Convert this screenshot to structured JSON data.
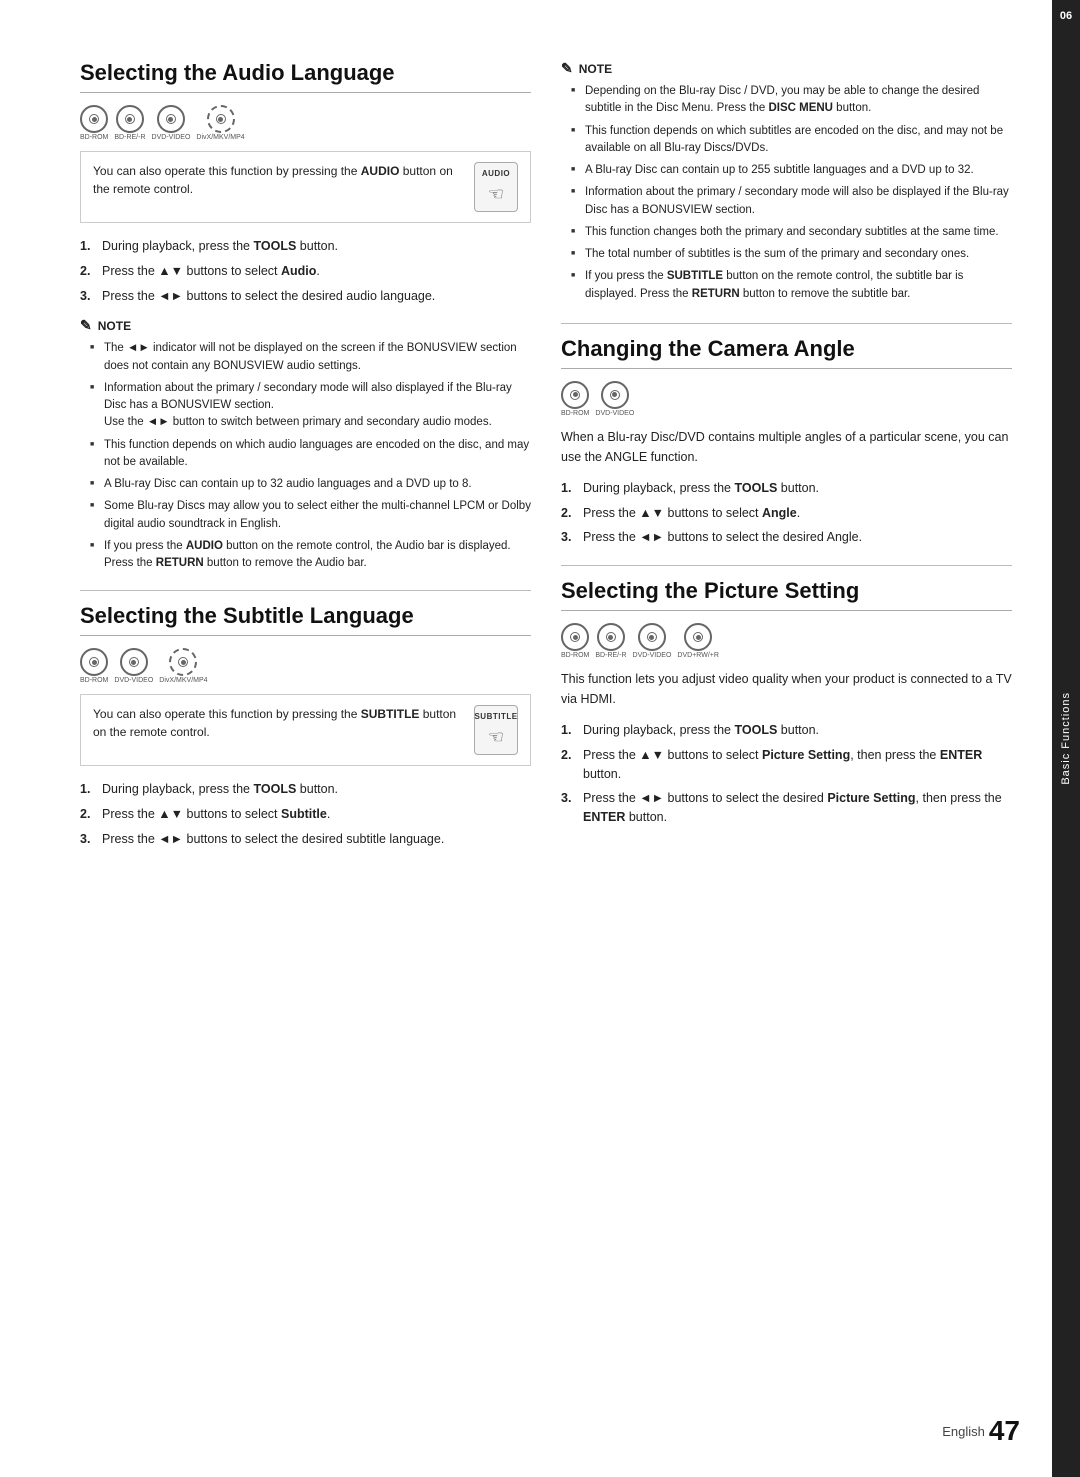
{
  "page": {
    "number": "47",
    "lang": "English"
  },
  "side_tab": {
    "number": "06",
    "label": "Basic Functions"
  },
  "sections": {
    "audio_language": {
      "title": "Selecting the Audio Language",
      "disc_icons": [
        "BD-ROM",
        "BD-RE/-R",
        "DVD-VIDEO",
        "DivX/MKV/MP4"
      ],
      "info_box": {
        "text_before": "You can also operate this function by pressing the ",
        "bold": "AUDIO",
        "text_after": " button on the remote control.",
        "button_label": "AUDIO"
      },
      "steps": [
        {
          "num": "1.",
          "text_before": "During playback, press the ",
          "bold": "TOOLS",
          "text_after": " button."
        },
        {
          "num": "2.",
          "text_before": "Press the ▲▼ buttons to select ",
          "bold": "Audio",
          "text_after": "."
        },
        {
          "num": "3.",
          "text": "Press the ◄► buttons to select the desired audio language."
        }
      ],
      "note": {
        "items": [
          "The ◄► indicator will not be displayed on the screen if the BONUSVIEW section does not contain any BONUSVIEW audio settings.",
          "Information about the primary / secondary mode will also displayed if the Blu-ray Disc has a BONUSVIEW section.\nUse the ◄► button to switch between primary and secondary audio modes.",
          "This function depends on which audio languages are encoded on the disc, and may not be available.",
          "A Blu-ray Disc can contain up to 32 audio languages and a DVD up to 8.",
          "Some Blu-ray Discs may allow you to select either the multi-channel LPCM or Dolby digital audio soundtrack in English.",
          "If you press the AUDIO button on the remote control, the Audio bar is displayed.\nPress the RETURN button to remove the Audio bar."
        ],
        "bold_in_last": [
          "AUDIO",
          "RETURN"
        ]
      }
    },
    "subtitle_language": {
      "title": "Selecting the Subtitle Language",
      "disc_icons": [
        "BD-ROM",
        "DVD-VIDEO",
        "DivX/MKV/MP4"
      ],
      "info_box": {
        "text_before": "You can also operate this function by pressing the ",
        "bold": "SUBTITLE",
        "text_after": " button on the remote control.",
        "button_label": "SUBTITLE"
      },
      "steps": [
        {
          "num": "1.",
          "text_before": "During playback, press the ",
          "bold": "TOOLS",
          "text_after": " button."
        },
        {
          "num": "2.",
          "text_before": "Press the ▲▼ buttons to select ",
          "bold": "Subtitle",
          "text_after": "."
        },
        {
          "num": "3.",
          "text": "Press the ◄► buttons to select the desired subtitle language."
        }
      ]
    },
    "right_note": {
      "items": [
        "Depending on the Blu-ray Disc / DVD, you may be able to change the desired subtitle in the Disc Menu. Press the DISC MENU button.",
        "This function depends on which subtitles are encoded on the disc, and may not be available on all Blu-ray Discs/DVDs.",
        "A Blu-ray Disc can contain up to 255 subtitle languages and a DVD up to 32.",
        "Information about the primary / secondary mode will also be displayed if the Blu-ray Disc has a BONUSVIEW section.",
        "This function changes both the primary and secondary subtitles at the same time.",
        "The total number of subtitles is the sum of the primary and secondary ones.",
        "If you press the SUBTITLE button on the remote control, the subtitle bar is displayed. Press the RETURN button to remove the subtitle bar."
      ]
    },
    "camera_angle": {
      "title": "Changing the Camera Angle",
      "disc_icons": [
        "BD-ROM",
        "DVD-VIDEO"
      ],
      "intro": "When a Blu-ray Disc/DVD contains multiple angles of a particular scene, you can use the ANGLE function.",
      "steps": [
        {
          "num": "1.",
          "text_before": "During playback, press the ",
          "bold": "TOOLS",
          "text_after": " button."
        },
        {
          "num": "2.",
          "text_before": "Press the ▲▼ buttons to select ",
          "bold": "Angle",
          "text_after": "."
        },
        {
          "num": "3.",
          "text": "Press the ◄► buttons to select the desired Angle."
        }
      ]
    },
    "picture_setting": {
      "title": "Selecting the Picture Setting",
      "disc_icons": [
        "BD-ROM",
        "BD-RE/-R",
        "DVD-VIDEO",
        "DVD+RW/+R"
      ],
      "intro_before": "This function lets you adjust video quality when your product is connected to a TV via HDMI.",
      "steps": [
        {
          "num": "1.",
          "text_before": "During playback, press the ",
          "bold": "TOOLS",
          "text_after": " button."
        },
        {
          "num": "2.",
          "text_before": "Press the ▲▼ buttons to select ",
          "bold": "Picture Setting",
          "text_after": ", then press the ",
          "bold2": "ENTER",
          "text_after2": " button."
        },
        {
          "num": "3.",
          "text_before": "Press the ◄► buttons to select the desired ",
          "bold": "Picture Setting",
          "text_after": ", then press the ",
          "bold2": "ENTER",
          "text_after2": " button."
        }
      ]
    }
  }
}
